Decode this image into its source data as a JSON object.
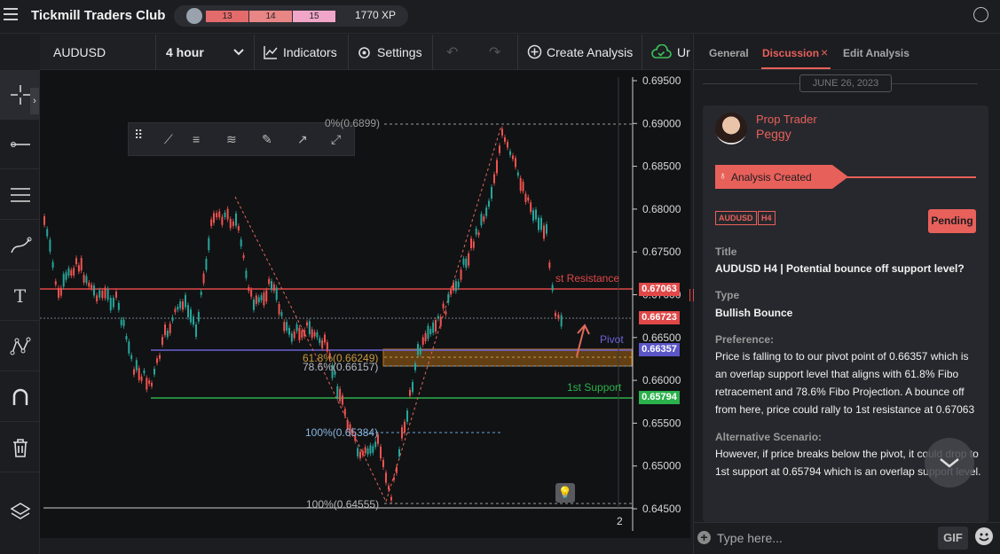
{
  "header": {
    "app_title": "Tickmill Traders Club",
    "levels": [
      "13",
      "14",
      "15"
    ],
    "xp": "1770 XP"
  },
  "toolbar": {
    "symbol": "AUDUSD",
    "timeframe": "4 hour",
    "indicators": "Indicators",
    "settings": "Settings",
    "create_analysis": "Create Analysis",
    "extra": "Ur"
  },
  "chart": {
    "price_ticks": [
      "0.69500",
      "0.69000",
      "0.68500",
      "0.68000",
      "0.67500",
      "0.67000",
      "0.66500",
      "0.66000",
      "0.65500",
      "0.65000",
      "0.64500"
    ],
    "fib_top": "0%(0.6899)",
    "fib_618": "61.8%(0.66249)",
    "fib_786": "78.6%(0.66157)",
    "fib_100a": "100%(0.65384)",
    "fib_100b": "100%(0.64555)",
    "resistance_label": "st Resistance",
    "resistance_price": "0.67063",
    "current_price": "0.66723",
    "pivot_label": "Pivot",
    "pivot_price": "0.66357",
    "support_label": "1st Support",
    "support_price": "0.65794",
    "x_tick": "2",
    "colors": {
      "resistance": "#e04848",
      "pivot": "#6a62d6",
      "support": "#2bb24c",
      "up": "#26a69a",
      "down": "#ef5350"
    }
  },
  "panel": {
    "tabs": [
      "General",
      "Discussion",
      "Edit Analysis"
    ],
    "close": "×",
    "date": "JUNE 26, 2023",
    "author_role": "Prop Trader",
    "author_name": "Peggy",
    "banner": "Analysis Created",
    "tags": [
      "AUDUSD",
      "H4"
    ],
    "status": "Pending",
    "title_label": "Title",
    "title_value": "AUDUSD H4 | Potential bounce off support level?",
    "type_label": "Type",
    "type_value": "Bullish Bounce",
    "pref_label": "Preference:",
    "pref_text": "Price is falling to  to our pivot point of 0.66357 which is an overlap support level that aligns with 61.8% Fibo retracement and 78.6% Fibo Projection. A bounce off from here, price could rally to 1st resistance at 0.67063",
    "alt_label": "Alternative Scenario:",
    "alt_text": "However, if price breaks below the pivot, it could drop to 1st support at 0.65794 which is an overlap support level.",
    "input_placeholder": "Type here...",
    "gif": "GIF"
  }
}
